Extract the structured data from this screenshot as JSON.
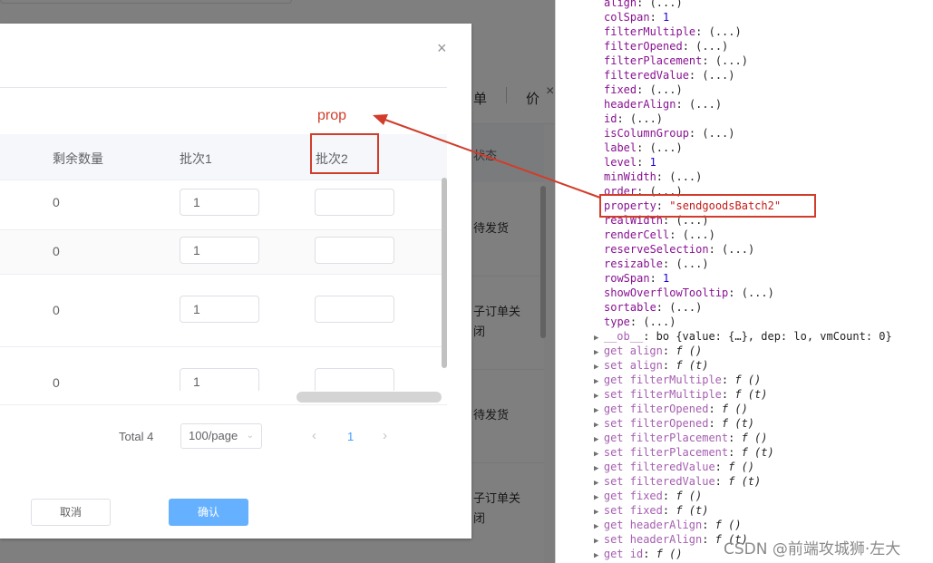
{
  "background": {
    "tabs": [
      "单",
      "价"
    ],
    "close_glyph": "×",
    "column_header": "状态",
    "rows": [
      "待发货",
      "子订单关闭",
      "待发货",
      "子订单关闭"
    ]
  },
  "dialog": {
    "close_glyph": "×",
    "columns": [
      "剩余数量",
      "批次1",
      "批次2"
    ],
    "rows": [
      {
        "remaining": "0",
        "batch1": "1",
        "batch2": ""
      },
      {
        "remaining": "0",
        "batch1": "1",
        "batch2": ""
      },
      {
        "remaining": "0",
        "batch1": "1",
        "batch2": ""
      },
      {
        "remaining": "0",
        "batch1": "1",
        "batch2": ""
      }
    ],
    "pagination": {
      "total": "Total 4",
      "page_size": "100/page",
      "current_page": "1",
      "prev": "‹",
      "next": "›",
      "caret": "⌄"
    },
    "cancel_label": "取消",
    "confirm_label": "确认"
  },
  "annotation": {
    "label": "prop",
    "color": "#d23c2a"
  },
  "devtools": {
    "lines": [
      {
        "kind": "prop",
        "name": "align",
        "value": "(...)"
      },
      {
        "kind": "prop",
        "name": "colSpan",
        "value": "1",
        "num": true
      },
      {
        "kind": "prop",
        "name": "filterMultiple",
        "value": "(...)"
      },
      {
        "kind": "prop",
        "name": "filterOpened",
        "value": "(...)"
      },
      {
        "kind": "prop",
        "name": "filterPlacement",
        "value": "(...)"
      },
      {
        "kind": "prop",
        "name": "filteredValue",
        "value": "(...)"
      },
      {
        "kind": "prop",
        "name": "fixed",
        "value": "(...)"
      },
      {
        "kind": "prop",
        "name": "headerAlign",
        "value": "(...)"
      },
      {
        "kind": "prop",
        "name": "id",
        "value": "(...)"
      },
      {
        "kind": "prop",
        "name": "isColumnGroup",
        "value": "(...)"
      },
      {
        "kind": "prop",
        "name": "label",
        "value": "(...)"
      },
      {
        "kind": "prop",
        "name": "level",
        "value": "1",
        "num": true
      },
      {
        "kind": "prop",
        "name": "minWidth",
        "value": "(...)"
      },
      {
        "kind": "prop",
        "name": "order",
        "value": "(...)"
      },
      {
        "kind": "prop",
        "name": "property",
        "value": "\"sendgoodsBatch2\"",
        "str": true
      },
      {
        "kind": "prop",
        "name": "realWidth",
        "value": "(...)"
      },
      {
        "kind": "prop",
        "name": "renderCell",
        "value": "(...)"
      },
      {
        "kind": "prop",
        "name": "reserveSelection",
        "value": "(...)"
      },
      {
        "kind": "prop",
        "name": "resizable",
        "value": "(...)"
      },
      {
        "kind": "prop",
        "name": "rowSpan",
        "value": "1",
        "num": true
      },
      {
        "kind": "prop",
        "name": "showOverflowTooltip",
        "value": "(...)"
      },
      {
        "kind": "prop",
        "name": "sortable",
        "value": "(...)"
      },
      {
        "kind": "prop",
        "name": "type",
        "value": "(...)"
      },
      {
        "kind": "ob",
        "name": "__ob__",
        "value": "bo {value: {…}, dep: lo, vmCount: 0}"
      },
      {
        "kind": "acc",
        "name": "get align",
        "value": "f ()"
      },
      {
        "kind": "acc",
        "name": "set align",
        "value": "f (t)"
      },
      {
        "kind": "acc",
        "name": "get filterMultiple",
        "value": "f ()"
      },
      {
        "kind": "acc",
        "name": "set filterMultiple",
        "value": "f (t)"
      },
      {
        "kind": "acc",
        "name": "get filterOpened",
        "value": "f ()"
      },
      {
        "kind": "acc",
        "name": "set filterOpened",
        "value": "f (t)"
      },
      {
        "kind": "acc",
        "name": "get filterPlacement",
        "value": "f ()"
      },
      {
        "kind": "acc",
        "name": "set filterPlacement",
        "value": "f (t)"
      },
      {
        "kind": "acc",
        "name": "get filteredValue",
        "value": "f ()"
      },
      {
        "kind": "acc",
        "name": "set filteredValue",
        "value": "f (t)"
      },
      {
        "kind": "acc",
        "name": "get fixed",
        "value": "f ()"
      },
      {
        "kind": "acc",
        "name": "set fixed",
        "value": "f (t)"
      },
      {
        "kind": "acc",
        "name": "get headerAlign",
        "value": "f ()"
      },
      {
        "kind": "acc",
        "name": "set headerAlign",
        "value": "f (t)"
      },
      {
        "kind": "acc",
        "name": "get id",
        "value": "f ()"
      }
    ]
  },
  "watermark": "CSDN @前端攻城狮·左大"
}
